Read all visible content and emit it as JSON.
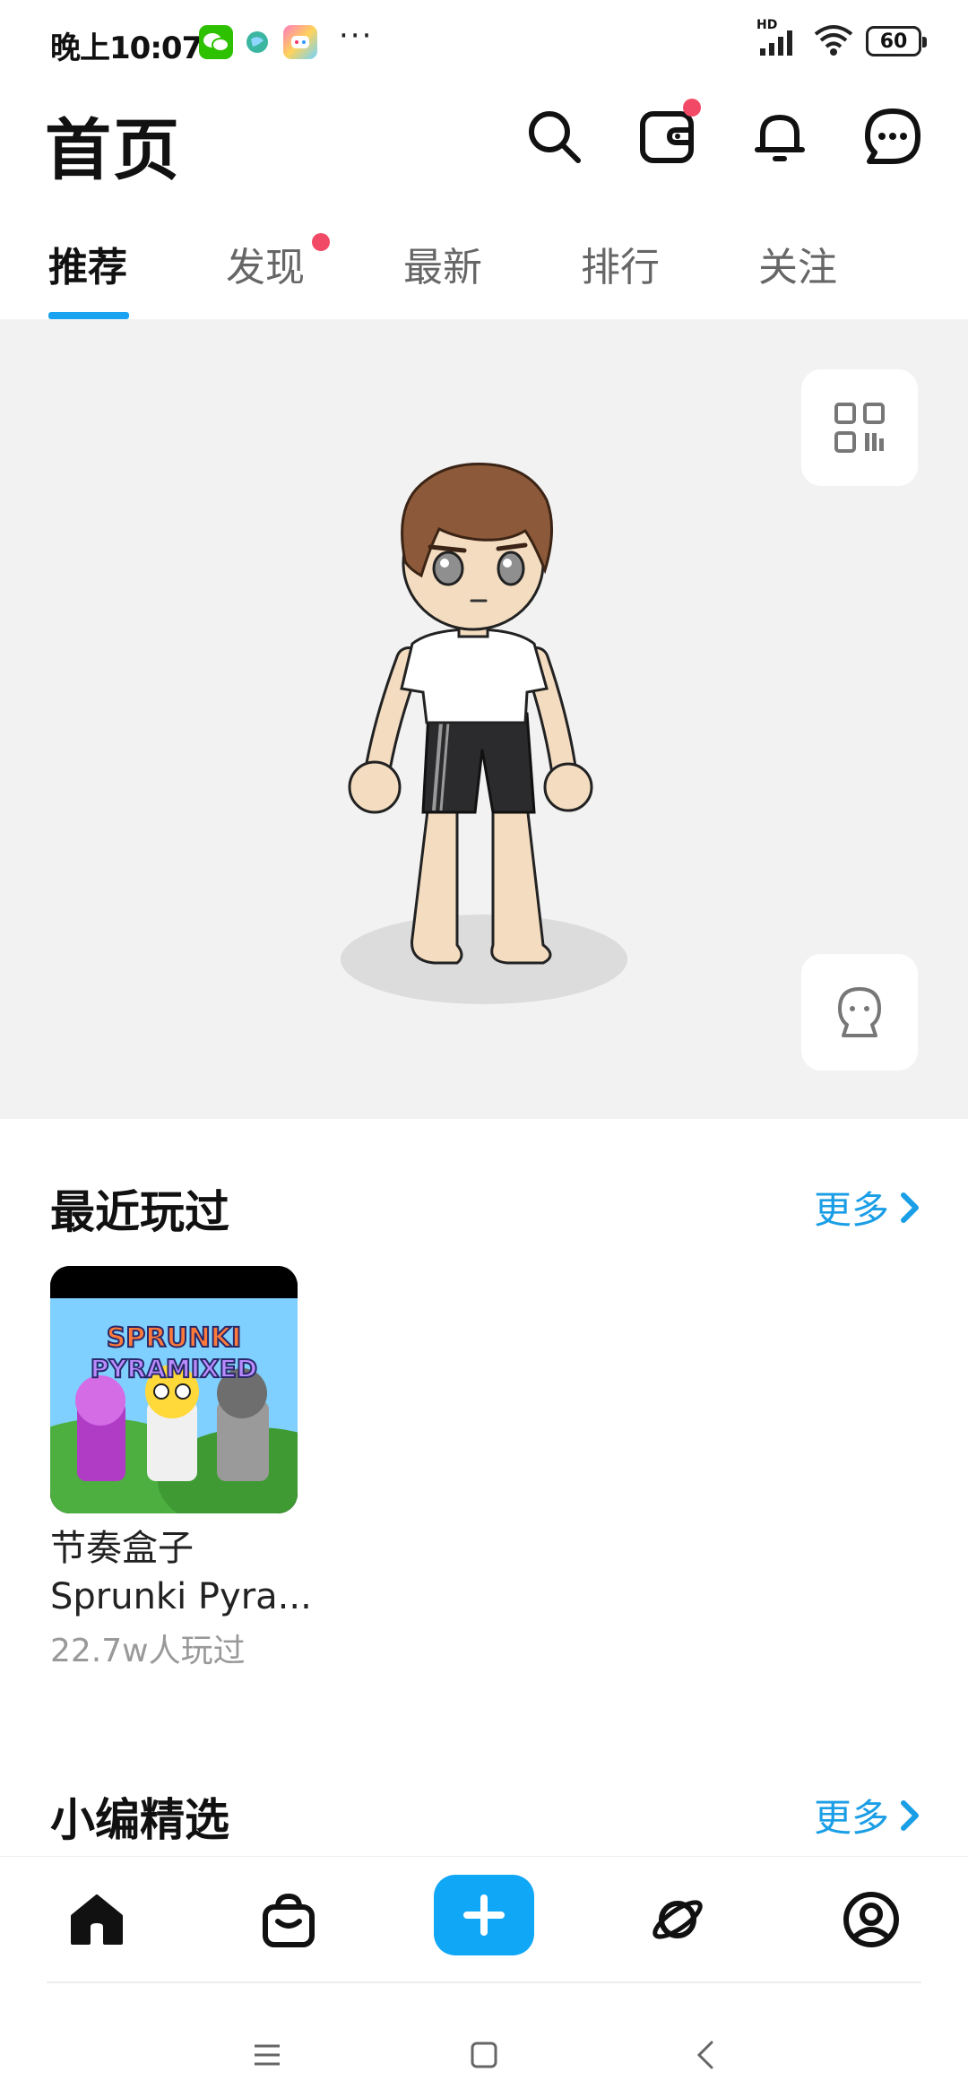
{
  "status_bar": {
    "time": "晚上10:07",
    "more": "···",
    "network": "HD",
    "battery": "60"
  },
  "header": {
    "title": "首页"
  },
  "tabs": [
    {
      "label": "推荐",
      "active": true
    },
    {
      "label": "发现",
      "badge": true
    },
    {
      "label": "最新"
    },
    {
      "label": "排行"
    },
    {
      "label": "关注"
    }
  ],
  "recent": {
    "title": "最近玩过",
    "more": "更多",
    "games": [
      {
        "name_line1": "节奏盒子",
        "name_line2": "Sprunki Pyra...",
        "stats": "22.7w人玩过",
        "thumb_text_1": "SPRUNKI",
        "thumb_text_2": "PYRAMIXED"
      }
    ]
  },
  "editors_pick": {
    "title": "小编精选",
    "more": "更多"
  },
  "bottom_nav": [
    {
      "icon": "home-icon",
      "active": true
    },
    {
      "icon": "shopping-bag-icon"
    },
    {
      "icon": "add-icon"
    },
    {
      "icon": "planet-icon"
    },
    {
      "icon": "profile-icon"
    }
  ],
  "colors": {
    "accent": "#1a9ee6",
    "badge": "#f24a66",
    "avatar_bg": "#f2f2f3"
  }
}
